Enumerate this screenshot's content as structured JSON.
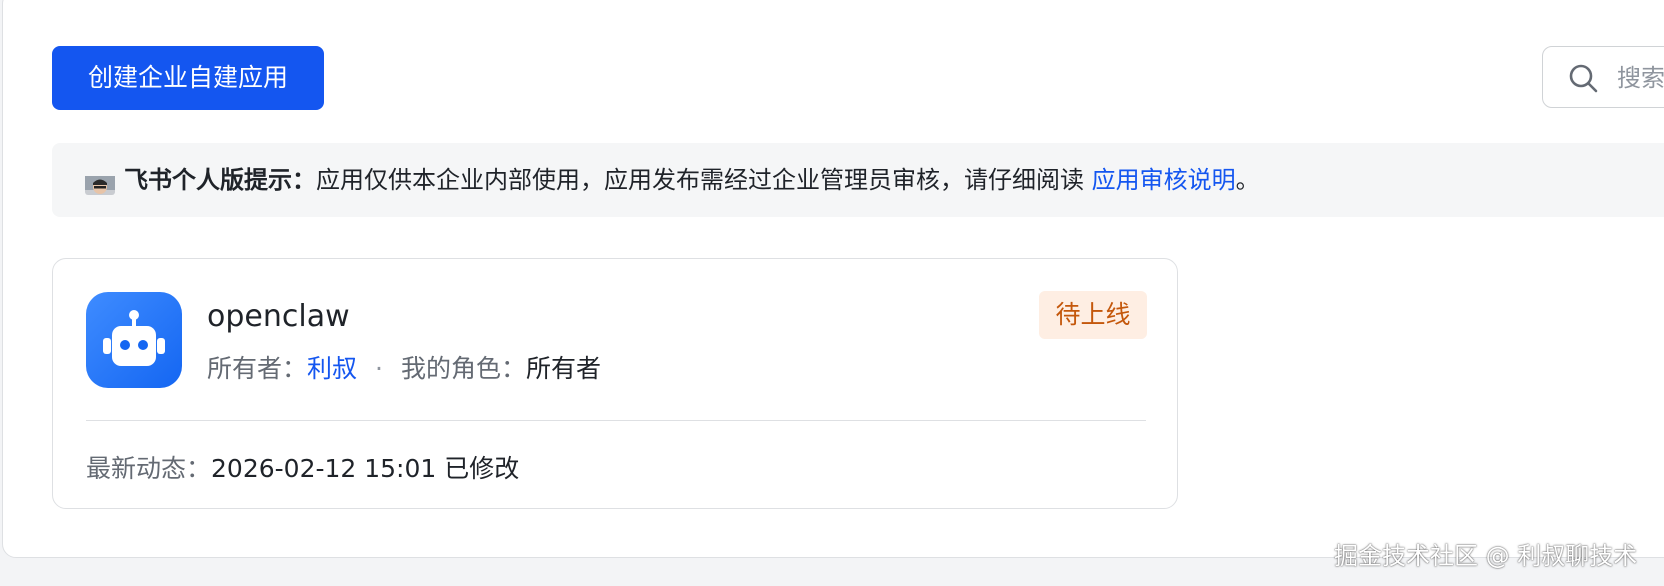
{
  "toolbar": {
    "create_button_label": "创建企业自建应用",
    "search_placeholder": "搜索"
  },
  "notice": {
    "title": "飞书个人版提示：",
    "message": "应用仅供本企业内部使用，应用发布需经过企业管理员审核，请仔细阅读 ",
    "link_text": "应用审核说明",
    "suffix": "。"
  },
  "app_card": {
    "name": "openclaw",
    "owner_label": "所有者：",
    "owner_name": "利叔",
    "separator": "·",
    "role_label": "我的角色：",
    "role_value": "所有者",
    "status": "待上线",
    "activity_label": "最新动态：",
    "activity_value": "2026-02-12 15:01 已修改"
  },
  "watermark": "掘金技术社区 @ 利叔聊技术",
  "colors": {
    "primary": "#1456f0",
    "status_bg": "#feeee3",
    "status_text": "#c4570b"
  },
  "icons": {
    "search": "search-icon",
    "notice_avatar": "user-avatar",
    "app": "robot-icon"
  }
}
